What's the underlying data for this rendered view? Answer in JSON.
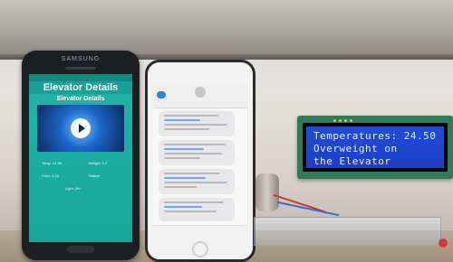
{
  "android": {
    "brand": "SAMSUNG",
    "app_title": "Elevator Details",
    "sub_title": "Elevator Details",
    "rows": [
      {
        "left": "Temp: 24.50",
        "right": "Weight: 1.2"
      },
      {
        "left": "Floor: 1.00",
        "right": "Status:"
      },
      {
        "left": "Light: 29*",
        "right": ""
      }
    ]
  },
  "lcd": {
    "line1": "Temperatures: 24.50",
    "line2": "Overweight on",
    "line3": "the Elevator"
  },
  "colors": {
    "app_bg": "#1fb3a8",
    "lcd_bg": "#234bd9",
    "lcd_text": "#e5f0ff",
    "pcb": "#2c7d55"
  }
}
